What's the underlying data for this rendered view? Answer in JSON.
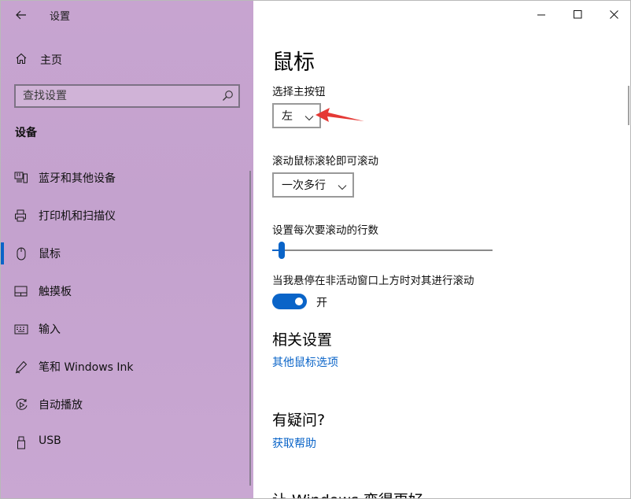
{
  "window": {
    "title": "设置",
    "controls": [
      "minimize",
      "maximize",
      "close"
    ]
  },
  "sidebar": {
    "home_label": "主页",
    "search_placeholder": "查找设置",
    "section_title": "设备",
    "items": [
      {
        "label": "蓝牙和其他设备",
        "icon": "bluetooth-devices-icon",
        "active": false
      },
      {
        "label": "打印机和扫描仪",
        "icon": "printer-icon",
        "active": false
      },
      {
        "label": "鼠标",
        "icon": "mouse-icon",
        "active": true
      },
      {
        "label": "触摸板",
        "icon": "touchpad-icon",
        "active": false
      },
      {
        "label": "输入",
        "icon": "keyboard-icon",
        "active": false
      },
      {
        "label": "笔和 Windows Ink",
        "icon": "pen-icon",
        "active": false
      },
      {
        "label": "自动播放",
        "icon": "autoplay-icon",
        "active": false
      },
      {
        "label": "USB",
        "icon": "usb-icon",
        "active": false
      }
    ]
  },
  "main": {
    "title": "鼠标",
    "primary_button": {
      "label": "选择主按钮",
      "value": "左"
    },
    "scroll_mode": {
      "label": "滚动鼠标滚轮即可滚动",
      "value": "一次多行"
    },
    "scroll_lines": {
      "label": "设置每次要滚动的行数",
      "value_fraction": 0.03
    },
    "inactive_scroll": {
      "label": "当我悬停在非活动窗口上方时对其进行滚动",
      "state": "开",
      "on": true
    },
    "related": {
      "title": "相关设置",
      "link": "其他鼠标选项"
    },
    "question": {
      "title": "有疑问?",
      "link": "获取帮助"
    },
    "improve": {
      "title": "让 Windows 变得更好"
    }
  },
  "colors": {
    "accent": "#0a64c8",
    "annotation_arrow": "#e53935"
  }
}
